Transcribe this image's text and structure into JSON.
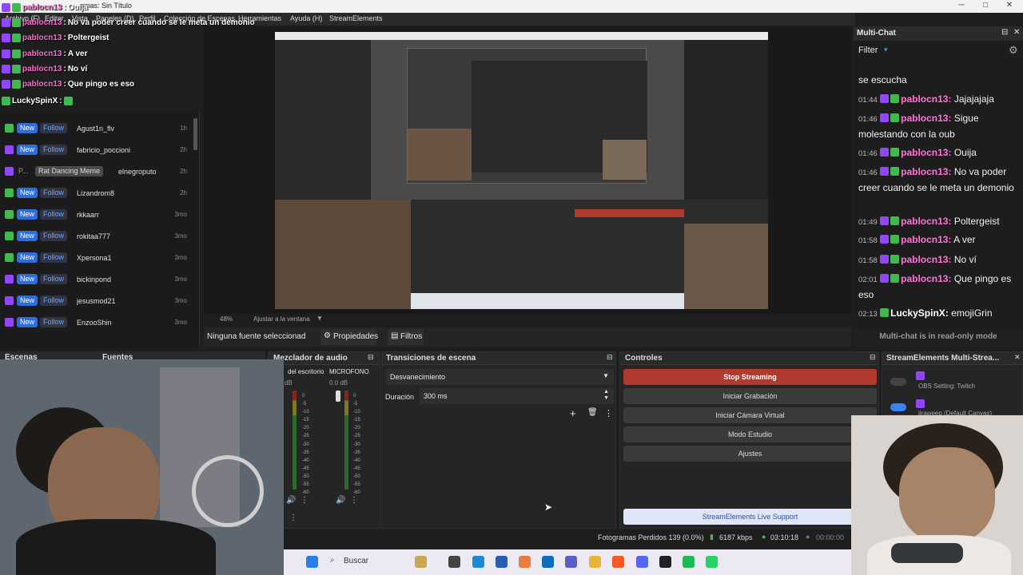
{
  "app": {
    "title_fragment": "amas: Sin Título",
    "menu": [
      "Archivo (F)",
      "Editar",
      "Vista",
      "Paneles (D)",
      "Perfil",
      "Colección de Escenas",
      "Herramientas",
      "Ayuda (H)",
      "StreamElements"
    ]
  },
  "overlay_chat": [
    {
      "user": "pablocn13",
      "message": "Ouija"
    },
    {
      "user": "pablocn13",
      "message": "No va poder creer cuando se le meta un demonio"
    },
    {
      "user": "pablocn13",
      "message": "Poltergeist"
    },
    {
      "user": "pablocn13",
      "message": "A ver"
    },
    {
      "user": "pablocn13",
      "message": "No ví"
    },
    {
      "user": "pablocn13",
      "message": "Que pingo es eso"
    },
    {
      "user": "LuckySpinX",
      "message": ""
    }
  ],
  "activity_feed": [
    {
      "badge": "New",
      "action": "Follow",
      "name": "Agust1n_flv",
      "time": "1h"
    },
    {
      "badge": "New",
      "action": "Follow",
      "name": "fabricio_poccioni",
      "time": "2h"
    },
    {
      "badge": "P...",
      "action": "Rat Dancing Meme",
      "name": "elnegroputo",
      "time": "2h"
    },
    {
      "badge": "New",
      "action": "Follow",
      "name": "Lizandrom8",
      "time": "2h"
    },
    {
      "badge": "New",
      "action": "Follow",
      "name": "rkkaarr",
      "time": "3mo"
    },
    {
      "badge": "New",
      "action": "Follow",
      "name": "rokitaa777",
      "time": "3mo"
    },
    {
      "badge": "New",
      "action": "Follow",
      "name": "Xpersona1",
      "time": "3mo"
    },
    {
      "badge": "New",
      "action": "Follow",
      "name": "bickinpond",
      "time": "3mo"
    },
    {
      "badge": "New",
      "action": "Follow",
      "name": "jesusmod21",
      "time": "3mo"
    },
    {
      "badge": "New",
      "action": "Follow",
      "name": "EnzooShin",
      "time": "3mo"
    }
  ],
  "preview": {
    "zoom": "48%",
    "fit_label": "Ajustar a la ventana"
  },
  "properties_bar": {
    "no_source": "Ninguna fuente seleccionad",
    "properties": "Propiedades",
    "filters": "Filtros"
  },
  "docks": {
    "scenes": "Escenas",
    "sources": "Fuentes",
    "audio_mixer": "Mezclador de audio",
    "transitions": "Transiciones de escena",
    "controls": "Controles",
    "se_multistream": "StreamElements Multi-Strea..."
  },
  "mixer": {
    "ch1_label": "del escritorio",
    "ch1_db": "dB",
    "ch2_label": "MICROFONO",
    "ch2_db": "0.0 dB",
    "scale": [
      "0",
      "-5",
      "-10",
      "-15",
      "-20",
      "-25",
      "-30",
      "-35",
      "-40",
      "-45",
      "-50",
      "-55",
      "-60"
    ]
  },
  "transitions": {
    "selected": "Desvanecimiento",
    "duration_label": "Duración",
    "duration_value": "300 ms"
  },
  "controls": {
    "stop_streaming": "Stop Streaming",
    "start_recording": "Iniciar Grabación",
    "virtual_camera": "Iniciar Cámara Virtual",
    "studio_mode": "Modo Estudio",
    "settings": "Ajustes",
    "live_support": "StreamElements Live Support"
  },
  "multistream": {
    "row1": "OBS Setting: Twitch",
    "row2": "jiraweep (Default Canvas)"
  },
  "status": {
    "dropped_frames": "Fotogramas Perdidos 139 (0.0%)",
    "bitrate": "6187 kbps",
    "stream_time": "03:10:18",
    "rec_time": "00:00:00"
  },
  "multichat": {
    "title": "Multi-Chat",
    "filter": "Filter",
    "read_only": "Multi-chat is in read-only mode",
    "messages": [
      {
        "time": "",
        "user": "",
        "text": "se escucha"
      },
      {
        "time": "01:44",
        "user": "pablocn13",
        "text": "Jajajajaja"
      },
      {
        "time": "01:46",
        "user": "pablocn13",
        "text": "Sigue molestando con la oub"
      },
      {
        "time": "01:46",
        "user": "pablocn13",
        "text": "Ouija"
      },
      {
        "time": "01:46",
        "user": "pablocn13",
        "text": "No va poder creer cuando se le meta un demonio"
      },
      {
        "time": "01:49",
        "user": "pablocn13",
        "text": "Poltergeist"
      },
      {
        "time": "01:58",
        "user": "pablocn13",
        "text": "A ver"
      },
      {
        "time": "01:58",
        "user": "pablocn13",
        "text": "No ví"
      },
      {
        "time": "02:01",
        "user": "pablocn13",
        "text": "Que pingo es eso"
      },
      {
        "time": "02:13",
        "user": "LuckySpinX",
        "text": "emojiGrin"
      }
    ]
  },
  "taskbar": {
    "search": "Buscar"
  },
  "colors": {
    "accent_red": "#b13a2e",
    "twitch_purple": "#9146ff",
    "username_pink": "#ff74d8",
    "follow_blue": "#2d6edb"
  }
}
